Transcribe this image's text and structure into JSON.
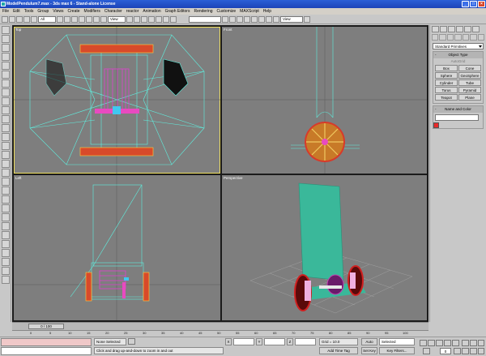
{
  "window": {
    "title": "ModelPendulum7.max    -  3ds max 6   -  Stand-alone License"
  },
  "menu": [
    "File",
    "Edit",
    "Tools",
    "Group",
    "Views",
    "Create",
    "Modifiers",
    "Character",
    "reactor",
    "Animation",
    "Graph Editors",
    "Rendering",
    "Customize",
    "MAXScript",
    "Help"
  ],
  "toolbar": {
    "selection_filter": "All",
    "reference_coord": "View",
    "named_selection": "",
    "render_view": "View"
  },
  "viewports": {
    "top": "Top",
    "front": "Front",
    "left": "Left",
    "perspective": "Perspective"
  },
  "command_panel": {
    "category": "Standard Primitives",
    "object_type_header": "Object Type",
    "autogrid": "AutoGrid",
    "primitives": [
      "Box",
      "Cone",
      "Sphere",
      "GeoSphere",
      "Cylinder",
      "Tube",
      "Torus",
      "Pyramid",
      "Teapot",
      "Plane"
    ],
    "name_color_header": "Name and Color",
    "rollout_marker": "-"
  },
  "timeline": {
    "slider": "0 / 100",
    "ticks": [
      "0",
      "5",
      "10",
      "15",
      "20",
      "25",
      "30",
      "35",
      "40",
      "45",
      "50",
      "55",
      "60",
      "65",
      "70",
      "75",
      "80",
      "85",
      "90",
      "95",
      "100"
    ]
  },
  "status": {
    "selection": "None Selected",
    "prompt": "Click and drag up-and-down to zoom in and out",
    "x_label": "X",
    "y_label": "Y",
    "z_label": "Z",
    "grid": "Grid = 10.0",
    "add_time_tag": "Add Time Tag",
    "auto_key": "Auto Key",
    "set_key": "Set Key",
    "key_mode": "Selected",
    "key_filters": "Key Filters...",
    "frame": "0"
  }
}
